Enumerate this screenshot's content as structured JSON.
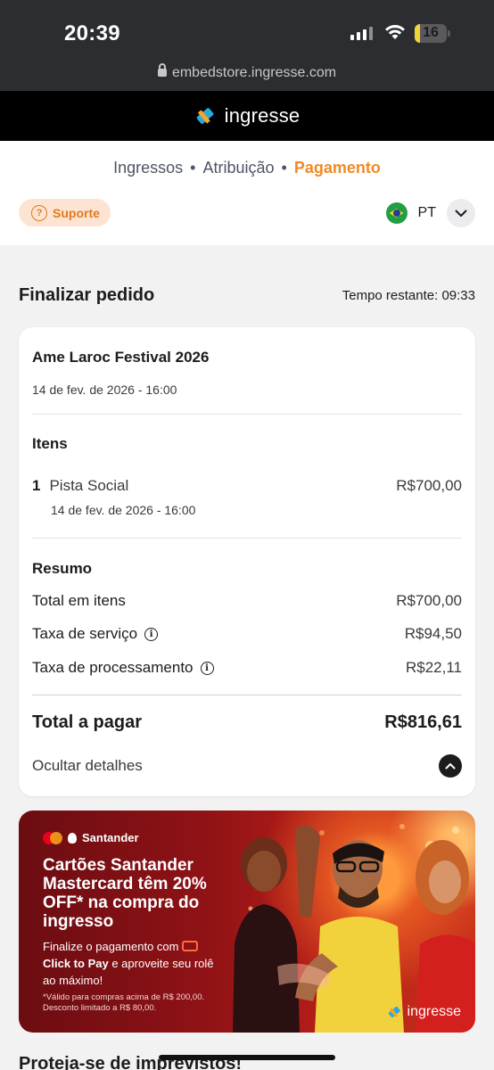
{
  "status_bar": {
    "time": "20:39",
    "battery": "16",
    "battery_level": 0.16
  },
  "browser": {
    "url": "embedstore.ingresse.com"
  },
  "brand": {
    "name": "ingresse"
  },
  "steps": {
    "step1": "Ingressos",
    "step2": "Atribuição",
    "step3": "Pagamento",
    "active": "Pagamento"
  },
  "support": {
    "label": "Suporte"
  },
  "language": {
    "code": "PT"
  },
  "order": {
    "title": "Finalizar pedido",
    "timer": "Tempo restante: 09:33",
    "event_name": "Ame Laroc Festival 2026",
    "event_date": "14 de fev. de 2026 - 16:00",
    "items_heading": "Itens",
    "items": [
      {
        "qty": "1",
        "name": "Pista Social",
        "date": "14 de fev. de 2026 - 16:00",
        "price": "R$700,00"
      }
    ],
    "summary_heading": "Resumo",
    "total_items_label": "Total em itens",
    "total_items_value": "R$700,00",
    "service_fee_label": "Taxa de serviço",
    "service_fee_value": "R$94,50",
    "processing_fee_label": "Taxa de processamento",
    "processing_fee_value": "R$22,11",
    "total_label": "Total a pagar",
    "total_value": "R$816,61",
    "hide_details": "Ocultar detalhes"
  },
  "banner": {
    "brand": "Santander",
    "headline": "Cartões Santander Mastercard têm 20% OFF* na compra do ingresso",
    "body_prefix": "Finalize o pagamento com",
    "body_bold": "Click to Pay",
    "body_suffix": "e aproveite seu rolê ao máximo!",
    "fine_print": "*Válido para compras acima de R$ 200,00. Desconto limitado a R$ 80,00.",
    "watermark": "ingresse"
  },
  "next_section": {
    "title": "Proteja-se de imprevistos!"
  },
  "colors": {
    "accent": "#f08a24",
    "support_bg": "#fde4d2",
    "dark": "#1c1c1e"
  }
}
